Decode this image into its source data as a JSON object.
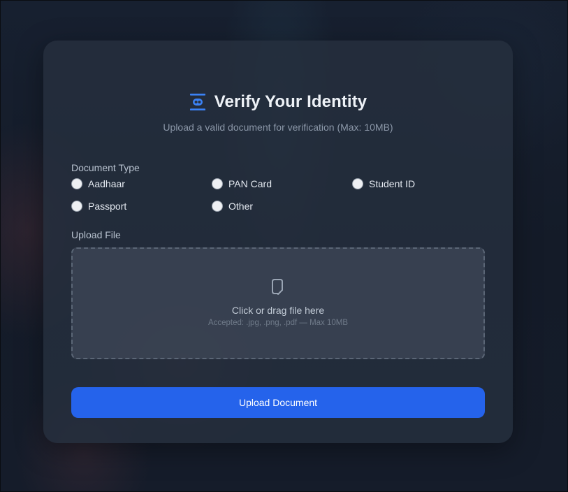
{
  "header": {
    "icon": "id-card-icon",
    "title": "Verify Your Identity",
    "subtitle": "Upload a valid document for verification (Max: 10MB)"
  },
  "document_type": {
    "label": "Document Type",
    "options": [
      {
        "label": "Aadhaar",
        "checked": false
      },
      {
        "label": "PAN Card",
        "checked": false
      },
      {
        "label": "Student ID",
        "checked": false
      },
      {
        "label": "Passport",
        "checked": false
      },
      {
        "label": "Other",
        "checked": false
      }
    ]
  },
  "upload": {
    "label": "Upload File",
    "icon": "file-upload-icon",
    "prompt": "Click or drag file here",
    "hint": "Accepted: .jpg, .png, .pdf — Max 10MB"
  },
  "submit": {
    "label": "Upload Document"
  },
  "colors": {
    "accent": "#2563eb",
    "card": "#26303e",
    "background": "#141c29"
  }
}
